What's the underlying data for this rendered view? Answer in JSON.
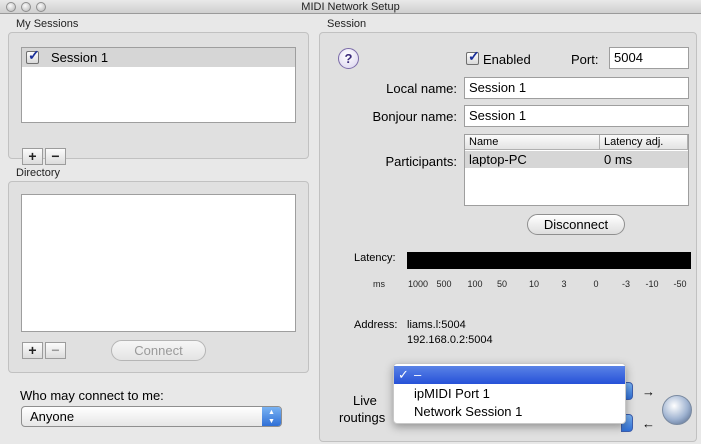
{
  "window": {
    "title": "MIDI Network Setup"
  },
  "my_sessions": {
    "heading": "My Sessions",
    "items": [
      {
        "label": "Session 1",
        "checked": true
      }
    ],
    "add_label": "+",
    "remove_label": "−"
  },
  "directory": {
    "heading": "Directory",
    "add_label": "+",
    "remove_label": "−",
    "connect_label": "Connect"
  },
  "who_may_connect": {
    "label": "Who may connect to me:",
    "value": "Anyone"
  },
  "session": {
    "heading": "Session",
    "help_label": "?",
    "enabled_label": "Enabled",
    "enabled": true,
    "port_label": "Port:",
    "port_value": "5004",
    "local_name_label": "Local name:",
    "local_name_value": "Session 1",
    "bonjour_name_label": "Bonjour name:",
    "bonjour_name_value": "Session 1",
    "participants_label": "Participants:",
    "participants_columns": [
      "Name",
      "Latency adj."
    ],
    "participants_rows": [
      {
        "name": "laptop-PC",
        "latency": "0 ms"
      }
    ],
    "disconnect_label": "Disconnect",
    "latency_label": "Latency:",
    "latency_scale": [
      "ms",
      "1000",
      "500",
      "100",
      "50",
      "10",
      "3",
      "0",
      "-3",
      "-10",
      "-50"
    ],
    "address_label": "Address:",
    "address_lines": [
      "liams.l:5004",
      "192.168.0.2:5004"
    ],
    "live_routings_label_1": "Live",
    "live_routings_label_2": "routings"
  },
  "routing_menu": {
    "items": [
      {
        "label": "–",
        "checked": true,
        "highlighted": true
      },
      {
        "label": "ipMIDI Port 1",
        "checked": false,
        "highlighted": false
      },
      {
        "label": "Network Session 1",
        "checked": false,
        "highlighted": false
      }
    ],
    "check_glyph": "✓"
  },
  "colors": {
    "accent": "#2651d8",
    "selection": "#d6d6d6"
  }
}
